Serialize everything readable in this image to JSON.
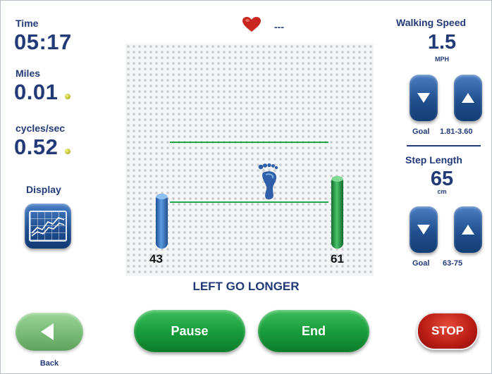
{
  "left": {
    "time_label": "Time",
    "time_value": "05:17",
    "miles_label": "Miles",
    "miles_value": "0.01",
    "cycles_label": "cycles/sec",
    "cycles_value": "0.52",
    "display_label": "Display"
  },
  "top": {
    "heart_rate": "---"
  },
  "speed": {
    "title": "Walking Speed",
    "value": "1.5",
    "unit": "MPH",
    "goal_label": "Goal",
    "goal_range": "1.81-3.60"
  },
  "step": {
    "title": "Step Length",
    "value": "65",
    "unit": "cm",
    "goal_label": "Goal",
    "goal_range": "63-75"
  },
  "gait": {
    "left_value": "43",
    "right_value": "61",
    "message": "LEFT GO LONGER"
  },
  "buttons": {
    "pause": "Pause",
    "end": "End",
    "stop": "STOP",
    "back": "Back"
  },
  "colors": {
    "navy_text": "#233a78",
    "green_button": "#169a3a",
    "blue_button": "#20508f",
    "stop_red": "#b91c14",
    "left_bar": "#2e6fc4",
    "right_bar": "#1f8a3c",
    "target_line": "#1ea84a",
    "heart": "#c8261f"
  },
  "icons": [
    "heart-icon",
    "footprint-icon",
    "graph-icon",
    "arrow-down-icon",
    "arrow-up-icon",
    "arrow-left-icon"
  ]
}
